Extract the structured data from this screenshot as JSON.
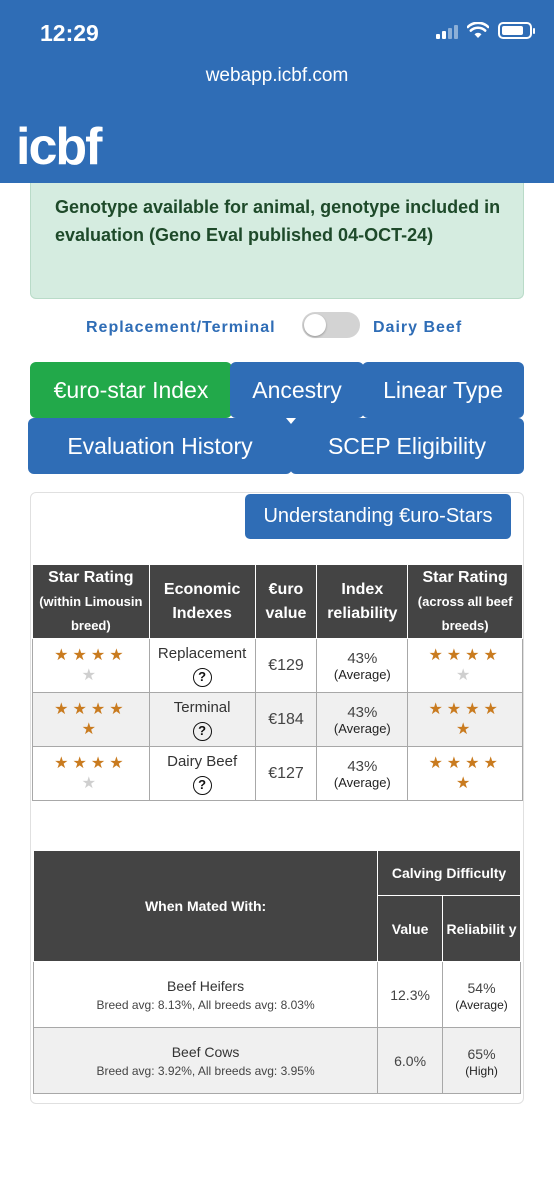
{
  "status_bar": {
    "time": "12:29"
  },
  "browser": {
    "url": "webapp.icbf.com"
  },
  "header": {
    "logo_text": "icbf"
  },
  "notice": {
    "text": "Genotype available for animal, genotype included in evaluation (Geno Eval published 04-OCT-24)"
  },
  "toggle": {
    "left_label": "Replacement/Terminal",
    "right_label": "Dairy Beef",
    "state": "off"
  },
  "tabs": [
    {
      "label": "€uro-star Index",
      "active": true
    },
    {
      "label": "Ancestry",
      "active": false
    },
    {
      "label": "Linear Type",
      "active": false
    },
    {
      "label": "Evaluation History",
      "active": false
    },
    {
      "label": "SCEP Eligibility",
      "active": false
    }
  ],
  "understand_button": "Understanding €uro-Stars",
  "star_table": {
    "headers": {
      "star_within_main": "Star Rating",
      "star_within_sub": "(within Limousin breed)",
      "economic": "Economic Indexes",
      "value": "€uro value",
      "reliability": "Index reliability",
      "star_across_main": "Star Rating",
      "star_across_sub": "(across all beef breeds)"
    },
    "rows": [
      {
        "stars_within": 4,
        "index": "Replacement",
        "value": "€129",
        "reliability": "43%",
        "reliability_label": "(Average)",
        "stars_across": 4
      },
      {
        "stars_within": 5,
        "index": "Terminal",
        "value": "€184",
        "reliability": "43%",
        "reliability_label": "(Average)",
        "stars_across": 5
      },
      {
        "stars_within": 4,
        "index": "Dairy Beef",
        "value": "€127",
        "reliability": "43%",
        "reliability_label": "(Average)",
        "stars_across": 5
      }
    ],
    "help_glyph": "?"
  },
  "calving_table": {
    "headers": {
      "mated_with": "When Mated With:",
      "calving": "Calving Difficulty",
      "value": "Value",
      "reliability": "Reliabilit y"
    },
    "rows": [
      {
        "name": "Beef Heifers",
        "avg": "Breed avg: 8.13%, All breeds avg: 8.03%",
        "value": "12.3%",
        "reliability": "54%",
        "reliability_label": "(Average)"
      },
      {
        "name": "Beef Cows",
        "avg": "Breed avg: 3.92%, All breeds avg: 3.95%",
        "value": "6.0%",
        "reliability": "65%",
        "reliability_label": "(High)"
      }
    ]
  },
  "colors": {
    "brand_blue": "#2f6db6",
    "active_green": "#22a94a",
    "notice_bg": "#d5ece0",
    "star_gold": "#c97b1f",
    "table_header": "#444444"
  }
}
